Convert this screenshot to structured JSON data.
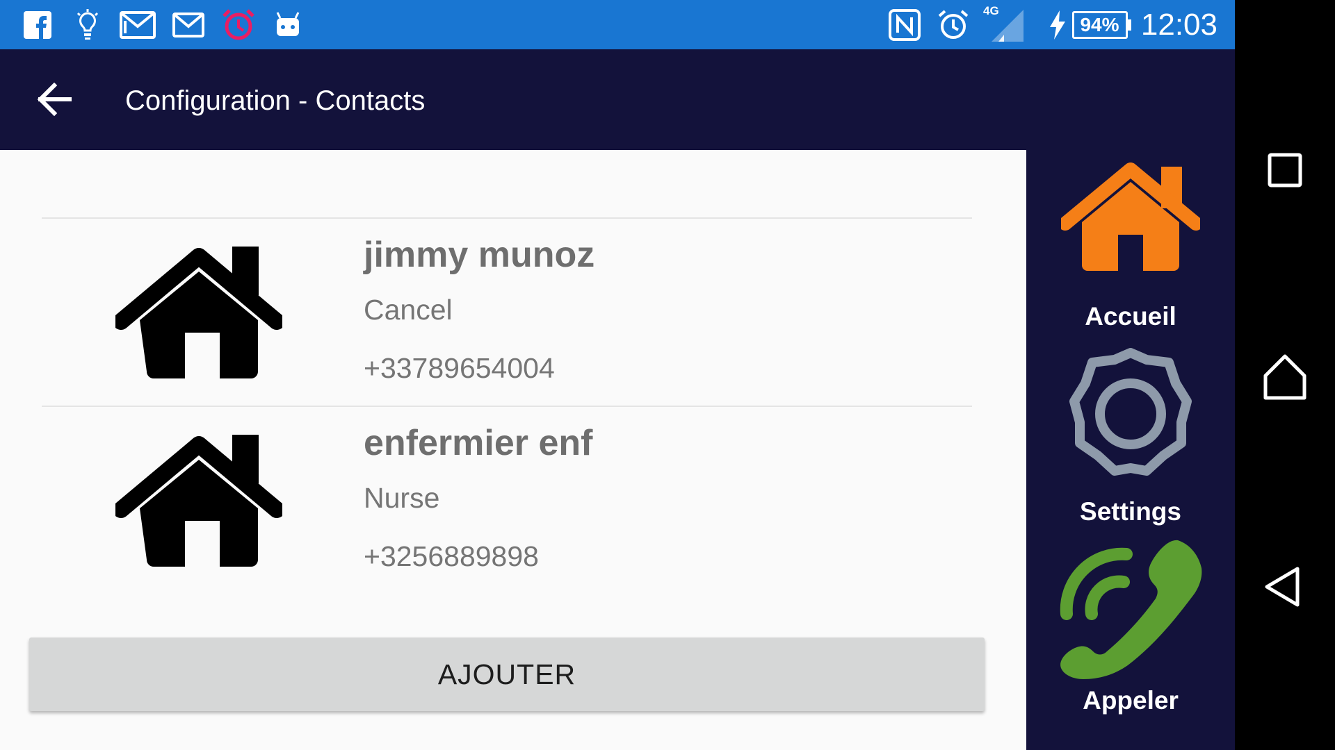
{
  "status_bar": {
    "time": "12:03",
    "battery": "94%",
    "network": "4G",
    "bg_color": "#1976d2",
    "icons": [
      "facebook-icon",
      "lightbulb-icon",
      "gmail-icon",
      "mail-icon",
      "alarm-clock-icon",
      "android-icon",
      "nfc-icon",
      "alarm-icon",
      "signal-icon",
      "charging-icon",
      "battery-icon"
    ]
  },
  "toolbar": {
    "title": "Configuration - Contacts",
    "bg_color": "#13123b",
    "back_icon": "arrow-back-icon"
  },
  "contacts": [
    {
      "name": "jimmy munoz",
      "role": "Cancel",
      "phone": "+33789654004",
      "icon": "home-icon"
    },
    {
      "name": "enfermier enf",
      "role": "Nurse",
      "phone": "+3256889898",
      "icon": "home-icon"
    }
  ],
  "add_button": {
    "label": "AJOUTER"
  },
  "side_nav": {
    "home": {
      "label": "Accueil",
      "icon": "home-icon",
      "color": "#f57f17"
    },
    "settings": {
      "label": "Settings",
      "icon": "gear-icon",
      "color": "#8e9aaa"
    },
    "call": {
      "label": "Appeler",
      "icon": "phone-icon",
      "color": "#5c9e31"
    }
  },
  "system_nav": {
    "recents_icon": "square-icon",
    "home_icon": "home-outline-icon",
    "back_icon": "triangle-back-icon"
  }
}
